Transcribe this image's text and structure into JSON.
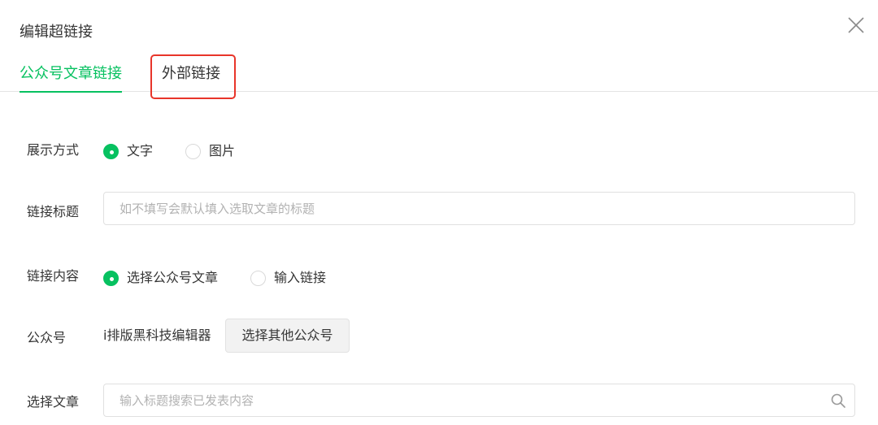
{
  "dialog": {
    "title": "编辑超链接"
  },
  "tabs": [
    {
      "label": "公众号文章链接",
      "active": true
    },
    {
      "label": "外部链接",
      "active": false
    }
  ],
  "display_mode": {
    "label": "展示方式",
    "options": [
      {
        "label": "文字",
        "checked": true
      },
      {
        "label": "图片",
        "checked": false
      }
    ]
  },
  "link_title": {
    "label": "链接标题",
    "value": "",
    "placeholder": "如不填写会默认填入选取文章的标题"
  },
  "link_content": {
    "label": "链接内容",
    "options": [
      {
        "label": "选择公众号文章",
        "checked": true
      },
      {
        "label": "输入链接",
        "checked": false
      }
    ]
  },
  "account": {
    "label": "公众号",
    "name": "i排版黑科技编辑器",
    "button_label": "选择其他公众号"
  },
  "select_article": {
    "label": "选择文章",
    "value": "",
    "placeholder": "输入标题搜索已发表内容"
  },
  "colors": {
    "accent": "#07c160",
    "highlight": "#e8352a",
    "text": "#353535",
    "placeholder": "#b2b2b2"
  },
  "icons": {
    "close": "close-icon",
    "search": "search-icon"
  }
}
